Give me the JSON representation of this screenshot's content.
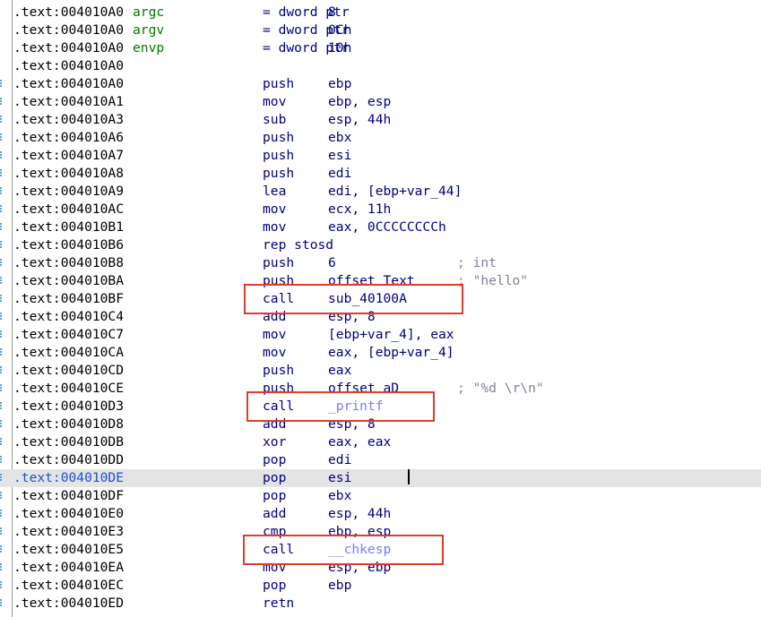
{
  "rows": [
    {
      "addr": ".text:004010A0",
      "label": "argc",
      "mn": "= dword ptr",
      "ops": "8",
      "cmt": ""
    },
    {
      "addr": ".text:004010A0",
      "label": "argv",
      "mn": "= dword ptr",
      "ops": "0Ch",
      "cmt": ""
    },
    {
      "addr": ".text:004010A0",
      "label": "envp",
      "mn": "= dword ptr",
      "ops": "10h",
      "cmt": ""
    },
    {
      "addr": ".text:004010A0",
      "label": "",
      "mn": "",
      "ops": "",
      "cmt": ""
    },
    {
      "addr": ".text:004010A0",
      "label": "",
      "mn": "push",
      "ops": "ebp",
      "cmt": ""
    },
    {
      "addr": ".text:004010A1",
      "label": "",
      "mn": "mov",
      "ops": "ebp, esp",
      "cmt": ""
    },
    {
      "addr": ".text:004010A3",
      "label": "",
      "mn": "sub",
      "ops": "esp, 44h",
      "cmt": ""
    },
    {
      "addr": ".text:004010A6",
      "label": "",
      "mn": "push",
      "ops": "ebx",
      "cmt": ""
    },
    {
      "addr": ".text:004010A7",
      "label": "",
      "mn": "push",
      "ops": "esi",
      "cmt": ""
    },
    {
      "addr": ".text:004010A8",
      "label": "",
      "mn": "push",
      "ops": "edi",
      "cmt": ""
    },
    {
      "addr": ".text:004010A9",
      "label": "",
      "mn": "lea",
      "ops": "edi, [ebp+var_44]",
      "cmt": ""
    },
    {
      "addr": ".text:004010AC",
      "label": "",
      "mn": "mov",
      "ops": "ecx, 11h",
      "cmt": ""
    },
    {
      "addr": ".text:004010B1",
      "label": "",
      "mn": "mov",
      "ops": "eax, 0CCCCCCCCh",
      "cmt": ""
    },
    {
      "addr": ".text:004010B6",
      "label": "",
      "mn": "rep stosd",
      "ops": "",
      "cmt": ""
    },
    {
      "addr": ".text:004010B8",
      "label": "",
      "mn": "push",
      "ops": "6",
      "cmt": "; int"
    },
    {
      "addr": ".text:004010BA",
      "label": "",
      "mn": "push",
      "ops": "offset Text",
      "cmt": "; \"hello\""
    },
    {
      "addr": ".text:004010BF",
      "label": "",
      "mn": "call",
      "ops": "sub_40100A",
      "cmt": ""
    },
    {
      "addr": ".text:004010C4",
      "label": "",
      "mn": "add",
      "ops": "esp, 8",
      "cmt": ""
    },
    {
      "addr": ".text:004010C7",
      "label": "",
      "mn": "mov",
      "ops": "[ebp+var_4], eax",
      "cmt": ""
    },
    {
      "addr": ".text:004010CA",
      "label": "",
      "mn": "mov",
      "ops": "eax, [ebp+var_4]",
      "cmt": ""
    },
    {
      "addr": ".text:004010CD",
      "label": "",
      "mn": "push",
      "ops": "eax",
      "cmt": ""
    },
    {
      "addr": ".text:004010CE",
      "label": "",
      "mn": "push",
      "ops": "offset aD",
      "cmt": "; \"%d \\r\\n\""
    },
    {
      "addr": ".text:004010D3",
      "label": "",
      "mn": "call",
      "ops": "_printf",
      "cmt": ""
    },
    {
      "addr": ".text:004010D8",
      "label": "",
      "mn": "add",
      "ops": "esp, 8",
      "cmt": ""
    },
    {
      "addr": ".text:004010DB",
      "label": "",
      "mn": "xor",
      "ops": "eax, eax",
      "cmt": ""
    },
    {
      "addr": ".text:004010DD",
      "label": "",
      "mn": "pop",
      "ops": "edi",
      "cmt": ""
    },
    {
      "addr": ".text:004010DE",
      "label": "",
      "mn": "pop",
      "ops": "esi",
      "cmt": "",
      "current": true
    },
    {
      "addr": ".text:004010DF",
      "label": "",
      "mn": "pop",
      "ops": "ebx",
      "cmt": ""
    },
    {
      "addr": ".text:004010E0",
      "label": "",
      "mn": "add",
      "ops": "esp, 44h",
      "cmt": ""
    },
    {
      "addr": ".text:004010E3",
      "label": "",
      "mn": "cmp",
      "ops": "ebp, esp",
      "cmt": ""
    },
    {
      "addr": ".text:004010E5",
      "label": "",
      "mn": "call",
      "ops": "__chkesp",
      "cmt": ""
    },
    {
      "addr": ".text:004010EA",
      "label": "",
      "mn": "mov",
      "ops": "esp, ebp",
      "cmt": ""
    },
    {
      "addr": ".text:004010EC",
      "label": "",
      "mn": "pop",
      "ops": "ebp",
      "cmt": ""
    },
    {
      "addr": ".text:004010ED",
      "label": "",
      "mn": "retn",
      "ops": "",
      "cmt": ""
    }
  ],
  "highlights": [
    {
      "row": 16,
      "label": "call sub_40100A"
    },
    {
      "row": 22,
      "label": "call _printf"
    },
    {
      "row": 30,
      "label": "call __chkesp"
    }
  ],
  "colors": {
    "highlight_box": "#e23b2e",
    "current_line": "#e4e4e4",
    "label_green": "#007a00",
    "mnemonic_navy": "#000080",
    "function_ref": "#7a7aff"
  }
}
